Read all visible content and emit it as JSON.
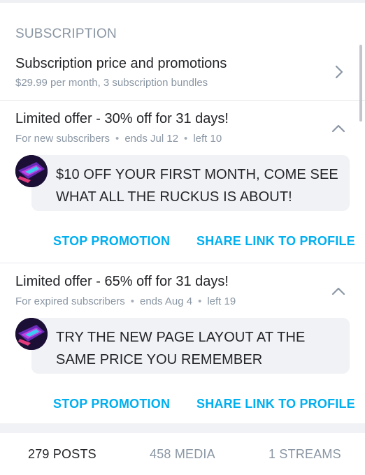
{
  "section": {
    "title": "SUBSCRIPTION"
  },
  "subscription": {
    "title": "Subscription price and promotions",
    "subtitle": "$29.99 per month, 3 subscription bundles"
  },
  "offers": [
    {
      "title": "Limited offer - 30% off for 31 days!",
      "audience": "For new subscribers",
      "ends": "ends Jul 12",
      "left": "left 10",
      "message": "$10 OFF YOUR FIRST MONTH, COME SEE WHAT ALL THE RUCKUS IS ABOUT!",
      "stop_label": "STOP PROMOTION",
      "share_label": "SHARE LINK TO PROFILE"
    },
    {
      "title": "Limited offer - 65% off for 31 days!",
      "audience": "For expired subscribers",
      "ends": "ends Aug 4",
      "left": "left 19",
      "message": "TRY THE NEW PAGE LAYOUT AT THE SAME PRICE YOU REMEMBER",
      "stop_label": "STOP PROMOTION",
      "share_label": "SHARE LINK TO PROFILE"
    }
  ],
  "tabs": [
    {
      "label": "279 POSTS"
    },
    {
      "label": "458 MEDIA"
    },
    {
      "label": "1 STREAMS"
    }
  ],
  "colors": {
    "accent": "#00aff0",
    "muted": "#8a96a3",
    "text": "#242529"
  },
  "icons": {
    "subscription_row": "chevron-right-icon",
    "offer_toggle": "chevron-up-icon"
  }
}
